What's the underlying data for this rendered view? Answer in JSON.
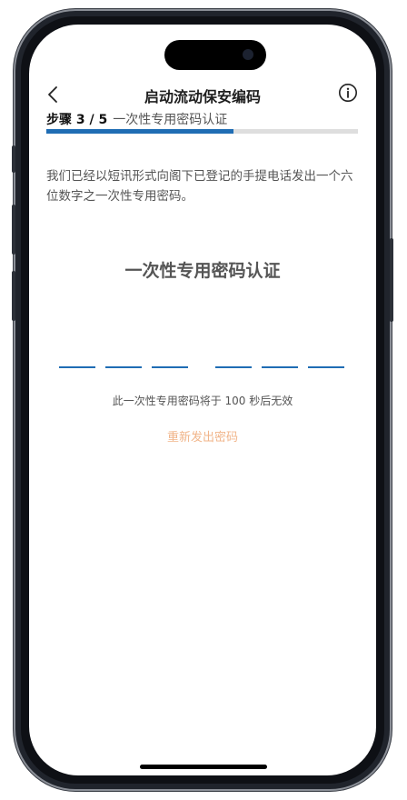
{
  "header": {
    "back_icon": "chevron-left-icon",
    "title": "启动流动保安编码",
    "info_icon": "info-circle-icon"
  },
  "step": {
    "label": "步骤 3 / 5",
    "subtitle": "一次性专用密码认证",
    "progress_fraction": 0.6
  },
  "description": "我们已经以短讯形式向阁下已登记的手提电话发出一个六位数字之一次性专用密码。",
  "otp": {
    "heading": "一次性专用密码认证",
    "digit_count": 6,
    "values": [
      "",
      "",
      "",
      "",
      "",
      ""
    ]
  },
  "expiry_text": "此一次性专用密码将于 100 秒后无效",
  "resend_label": "重新发出密码",
  "colors": {
    "accent": "#1f6db4",
    "resend": "#f1b58a",
    "track": "#dedede"
  }
}
